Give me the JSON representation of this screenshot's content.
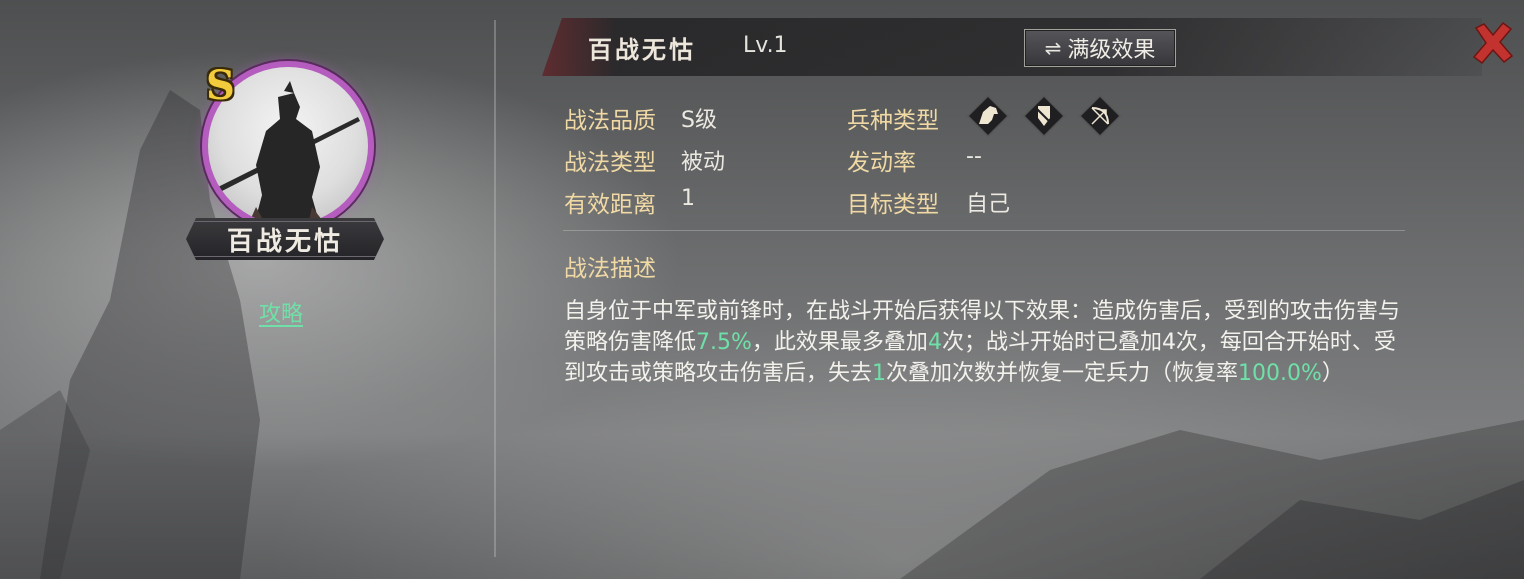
{
  "skill": {
    "name": "百战无怙",
    "level": "Lv.1",
    "grade_badge": "S",
    "guide_link": "攻略"
  },
  "header": {
    "max_effect_button": "满级效果",
    "swap_icon": "⇌",
    "close_icon": "red-x-close"
  },
  "attributes": {
    "quality_label": "战法品质",
    "quality_value": "S级",
    "type_label": "战法类型",
    "type_value": "被动",
    "range_label": "有效距离",
    "range_value": "1",
    "troop_label": "兵种类型",
    "troop_icons": [
      "cavalry-icon",
      "shield-icon",
      "archer-icon"
    ],
    "rate_label": "发动率",
    "rate_value": "--",
    "target_label": "目标类型",
    "target_value": "自己"
  },
  "description": {
    "title": "战法描述",
    "t1": "自身位于中军或前锋时，在战斗开始后获得以下效果：造成伤害后，受到的攻击伤害与策略伤害降低",
    "h1": "7.5%",
    "t2": "，此效果最多叠加",
    "h2": "4",
    "t3": "次；战斗开始时已叠加4次，每回合开始时、受到攻击或策略攻击伤害后，失去",
    "h3": "1",
    "t4": "次叠加次数并恢复一定兵力（恢复率",
    "h4": "100.0%",
    "t5": "）"
  },
  "colors": {
    "label": "#f0d9a4",
    "highlight": "#6fe0a7",
    "portrait_ring": "#b55cbf",
    "grade": "#f2cc3c",
    "close": "#c2332f"
  }
}
